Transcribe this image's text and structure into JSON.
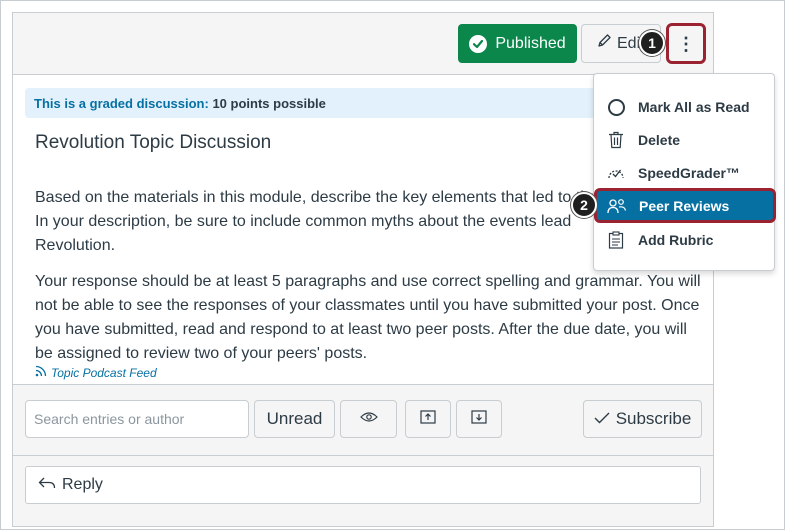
{
  "header": {
    "published_label": "Published",
    "edit_label": "Edit",
    "more_label": "⋮"
  },
  "callouts": {
    "one": "1",
    "two": "2"
  },
  "graded_banner": {
    "lead": "This is a graded discussion:",
    "points": "10 points possible"
  },
  "topic": {
    "title": "Revolution Topic Discussion",
    "paragraph1_line1": "Based on the materials in this module, describe the key elements that led to the",
    "paragraph1_line2": "In your description, be sure to include common myths about the events lead",
    "paragraph1_line3": "Revolution.",
    "paragraph2_line1": "Your response should be at least 5 paragraphs and use correct spelling and grammar. You will",
    "paragraph2_line2": "not be able to see the responses of your classmates until you have submitted your post. Once",
    "paragraph2_line3": "you have submitted, read and respond to at least two peer posts. After the due date, you will",
    "paragraph2_line4": "be assigned to review two of your peers' posts.",
    "podcast_link": "Topic Podcast Feed"
  },
  "toolbar": {
    "search_placeholder": "Search entries or author",
    "unread_label": "Unread",
    "subscribe_label": "Subscribe"
  },
  "reply": {
    "label": "Reply"
  },
  "menu": {
    "items": [
      {
        "label": "Mark All as Read",
        "icon": "circle-icon"
      },
      {
        "label": "Delete",
        "icon": "trash-icon"
      },
      {
        "label": "SpeedGrader™",
        "icon": "speedgrader-icon"
      },
      {
        "label": "Peer Reviews",
        "icon": "peer-reviews-icon",
        "highlighted": true
      },
      {
        "label": "Add Rubric",
        "icon": "rubric-icon"
      }
    ]
  },
  "colors": {
    "published_green": "#0b874b",
    "highlight_blue": "#0770a3",
    "callout_border": "#9b2331",
    "banner_bg": "#e2f1fb"
  }
}
